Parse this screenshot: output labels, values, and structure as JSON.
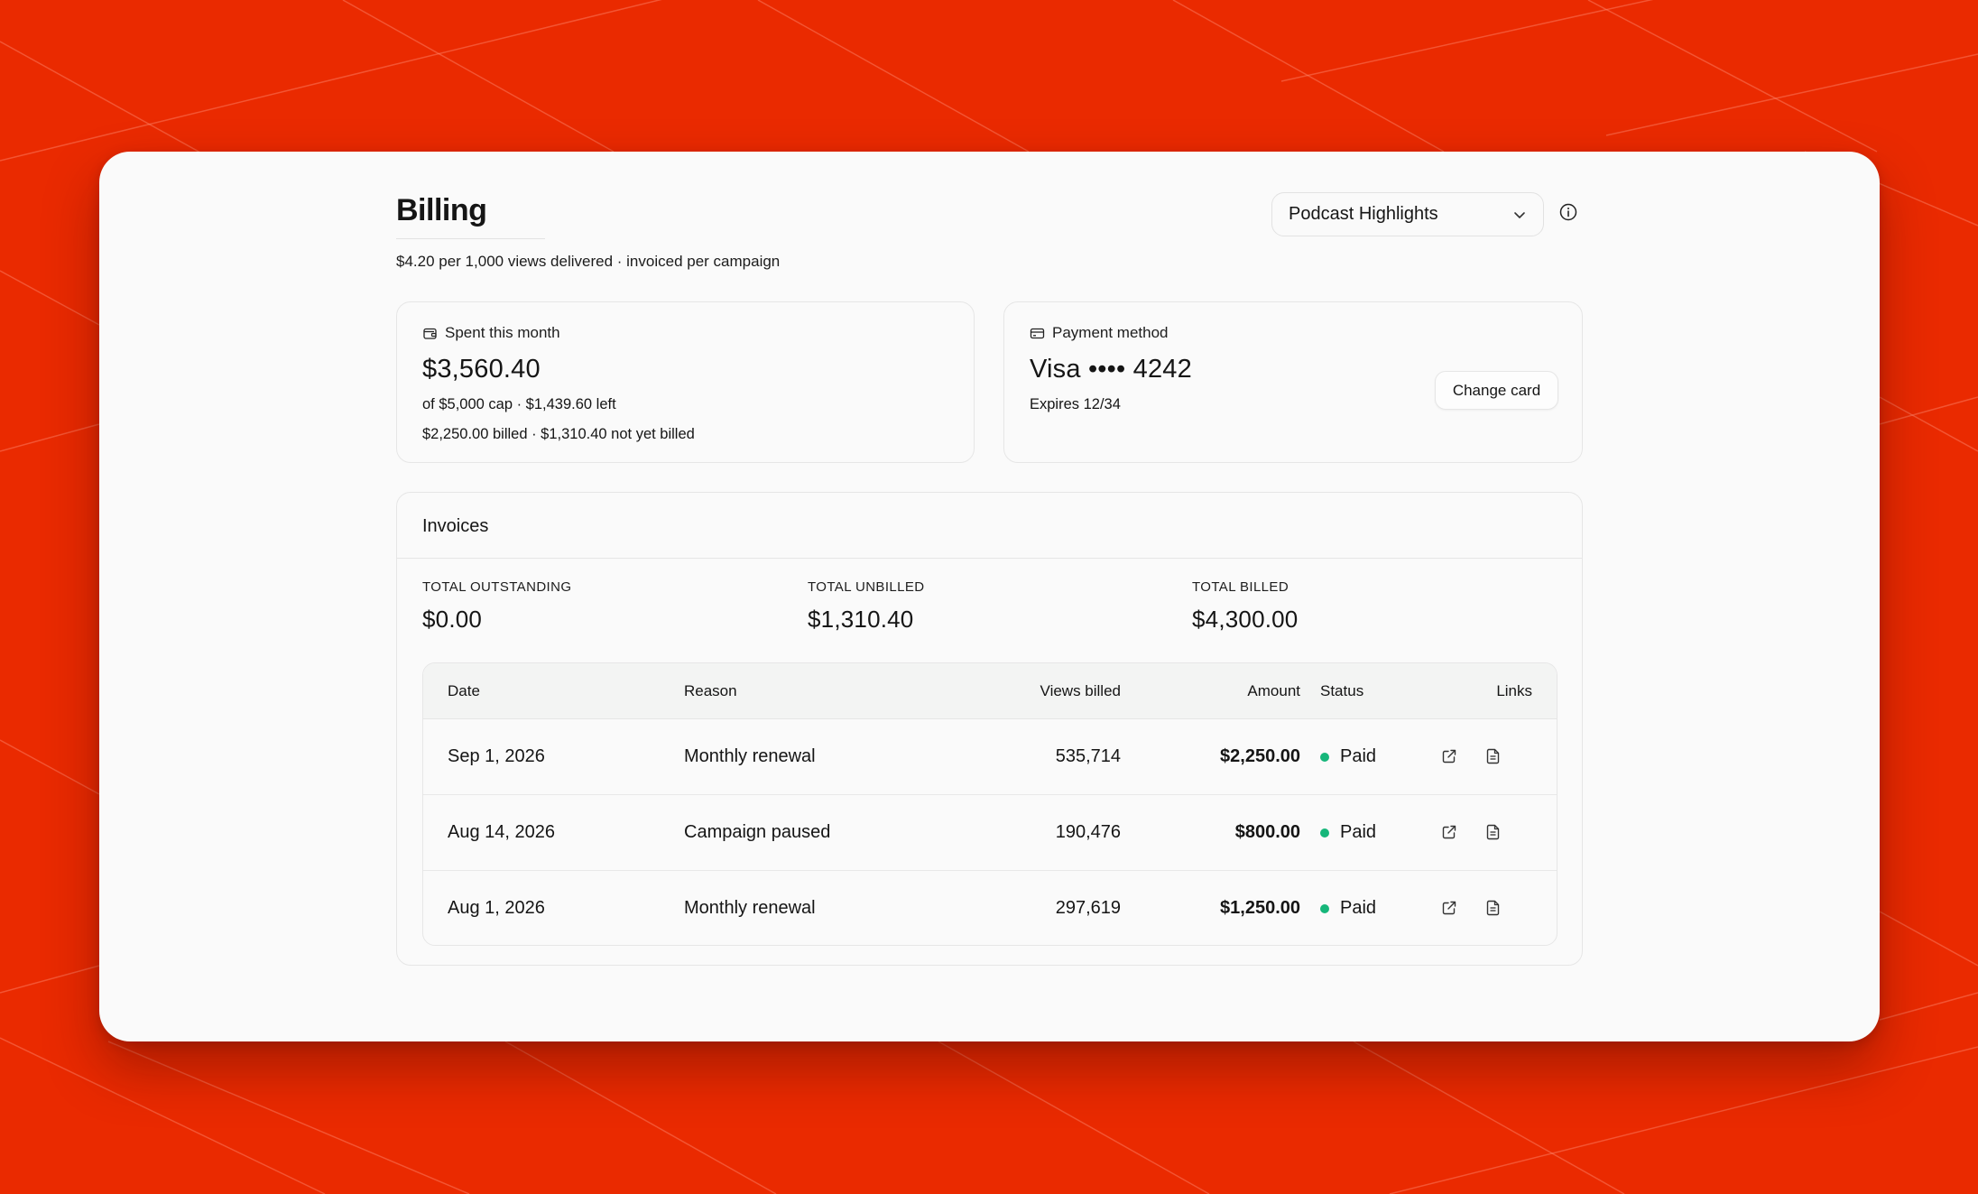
{
  "billing": {
    "title": "Billing",
    "subtitle": "$4.20 per 1,000 views delivered · invoiced per campaign",
    "campaign_selected": "Podcast Highlights"
  },
  "spent": {
    "label": "Spent this month",
    "value": "$3,560.40",
    "line1": "of $5,000 cap · $1,439.60 left",
    "line2": "$2,250.00 billed · $1,310.40 not yet billed"
  },
  "payment": {
    "label": "Payment method",
    "card": "Visa •••• 4242",
    "expires": "Expires 12/34",
    "change_label": "Change card"
  },
  "invoices": {
    "title": "Invoices",
    "stats": [
      {
        "label": "TOTAL OUTSTANDING",
        "value": "$0.00"
      },
      {
        "label": "TOTAL UNBILLED",
        "value": "$1,310.40"
      },
      {
        "label": "TOTAL BILLED",
        "value": "$4,300.00"
      }
    ],
    "columns": {
      "date": "Date",
      "reason": "Reason",
      "views": "Views billed",
      "amount": "Amount",
      "status": "Status",
      "links": "Links"
    },
    "rows": [
      {
        "date": "Sep 1, 2026",
        "reason": "Monthly renewal",
        "views": "535,714",
        "amount": "$2,250.00",
        "status": "Paid"
      },
      {
        "date": "Aug 14, 2026",
        "reason": "Campaign paused",
        "views": "190,476",
        "amount": "$800.00",
        "status": "Paid"
      },
      {
        "date": "Aug 1, 2026",
        "reason": "Monthly renewal",
        "views": "297,619",
        "amount": "$1,250.00",
        "status": "Paid"
      }
    ]
  },
  "icons": {
    "spent": "wallet-icon",
    "payment": "credit-card-icon",
    "select": "chevron-down-icon",
    "info": "info-icon",
    "open": "external-link-icon",
    "doc": "document-icon"
  },
  "colors": {
    "background": "#ea2a00",
    "status_paid": "#16b67a"
  }
}
